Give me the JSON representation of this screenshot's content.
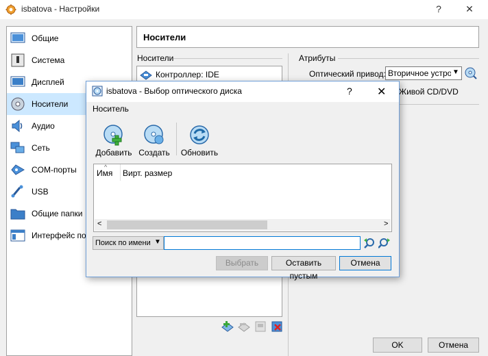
{
  "window": {
    "title": "isbatova - Настройки",
    "help": "?",
    "close": "✕"
  },
  "sidebar": {
    "items": [
      {
        "label": "Общие",
        "icon": "general-icon"
      },
      {
        "label": "Система",
        "icon": "system-icon"
      },
      {
        "label": "Дисплей",
        "icon": "display-icon"
      },
      {
        "label": "Носители",
        "icon": "storage-icon",
        "selected": true
      },
      {
        "label": "Аудио",
        "icon": "audio-icon"
      },
      {
        "label": "Сеть",
        "icon": "network-icon"
      },
      {
        "label": "COM-порты",
        "icon": "serial-ports-icon"
      },
      {
        "label": "USB",
        "icon": "usb-icon"
      },
      {
        "label": "Общие папки",
        "icon": "shared-folders-icon"
      },
      {
        "label": "Интерфейс по",
        "icon": "user-interface-icon"
      }
    ]
  },
  "page": {
    "title": "Носители"
  },
  "storage": {
    "section_label": "Носители",
    "controller_label": "Контроллер: IDE"
  },
  "attributes": {
    "section_label": "Атрибуты",
    "optical_drive_label": "Оптический привод:",
    "optical_drive_value": "Вторичное устройство",
    "live_cd_label": "Живой CD/DVD"
  },
  "buttons": {
    "ok": "OK",
    "cancel": "Отмена"
  },
  "dialog": {
    "title": "isbatova - Выбор оптического диска",
    "help": "?",
    "close": "✕",
    "section_label": "Носитель",
    "toolbar": [
      {
        "label": "Добавить",
        "icon": "add-disk-icon"
      },
      {
        "label": "Создать",
        "icon": "create-disk-icon"
      },
      {
        "label": "Обновить",
        "icon": "refresh-icon"
      }
    ],
    "table": {
      "columns": [
        "Имя",
        "Вирт. размер"
      ],
      "rows": []
    },
    "filter": {
      "mode": "Поиск по имени",
      "value": ""
    },
    "buttons": {
      "choose": "Выбрать",
      "leave_empty": "Оставить пустым",
      "cancel": "Отмена"
    }
  },
  "colors": {
    "selection": "#cce8ff",
    "accent": "#0078d7"
  }
}
